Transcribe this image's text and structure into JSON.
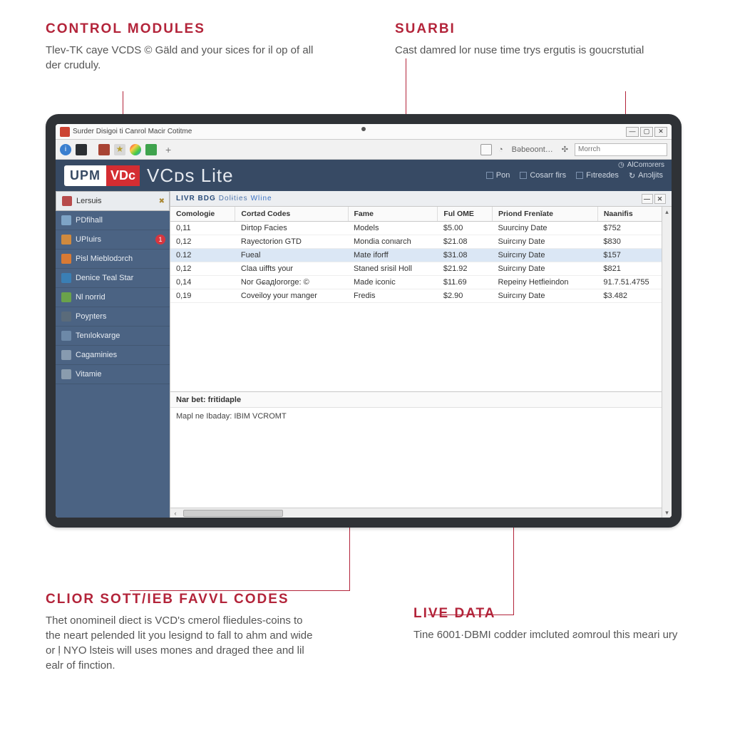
{
  "callouts": {
    "top_left": {
      "title": "CONTROL MODULES",
      "body": "Tlev-TK caye VCDS © Gäld and your sices for il op of all der cruduly."
    },
    "top_right": {
      "title": "SUАRBІ",
      "body": "Cast damred lor nuse time trys ergutis is goucrstutial"
    },
    "bottom_left": {
      "title": "CLIOR SOTТ/IЕB FAVVL CODES",
      "body": "Thet onomineil diect is VCD's сmerol fliedules-coins to the neart pelended lit you lesignd to fall to ahm and wide or ḷ NYO lsteis will uses mones and draged thee and lil ealr of finction."
    },
    "bottom_right": {
      "title": "LIVE DATA",
      "body": "Tine 6001·DBMI codder imcluted ƨomroul this meari ury"
    }
  },
  "window": {
    "title": "Surder Disigoi ti Canrol Macir Cotitme",
    "win_min": "—",
    "win_max": "▢",
    "win_close": "✕"
  },
  "tabbar": {
    "plus": "+",
    "addr_label": "Вəbeoont…",
    "search_placeholder": "Morrch"
  },
  "brand": {
    "logo_upm": "UPM",
    "logo_vd": "VDс",
    "logo_title": "VCᴅѕ Lite",
    "top_right": "AlComɔrers",
    "links": [
      {
        "icon": "page",
        "label": "Pon"
      },
      {
        "icon": "monitor",
        "label": "Cosarr firs"
      },
      {
        "icon": "grid",
        "label": "Fıtreƨdes"
      },
      {
        "icon": "refresh",
        "label": "Anɔljits"
      }
    ]
  },
  "sidebar": {
    "items": [
      {
        "icon": "#b74b4b",
        "label": "Lersuɨs",
        "active": true,
        "trail": "x"
      },
      {
        "icon": "#7ea4c6",
        "label": "PDfihall"
      },
      {
        "icon": "#d08a3e",
        "label": "UPIuirs",
        "badge": "1"
      },
      {
        "icon": "#d87a34",
        "label": "Рisl Mieblodɔrch"
      },
      {
        "icon": "#3a7fb5",
        "label": "Denice Теal Star"
      },
      {
        "icon": "#6aa24b",
        "label": "Nl norrid"
      },
      {
        "icon": "#5a6b7a",
        "label": "Poyɲters"
      },
      {
        "icon": "#6d89a8",
        "label": "Tenılokvarge"
      },
      {
        "icon": "#879bb0",
        "label": "Cagaminies"
      },
      {
        "icon": "#8a9cae",
        "label": "Vitamie"
      }
    ]
  },
  "panel": {
    "header_bold": "LIVR BDG",
    "header_thin_1": "Dolɨties",
    "header_thin_2": "Wline",
    "min": "—",
    "close": "✕"
  },
  "table": {
    "columns": [
      "Comologie",
      "Cortƨd Codes",
      "Fame",
      "Ful OME",
      "Priond Frenǐate",
      "Naanifis"
    ],
    "rows": [
      [
        "0,11",
        "Dirtop Facies",
        "Models",
        "$5.00",
        "Suurciny Date",
        "$752"
      ],
      [
        "0,12",
        "Rayectorion GTD",
        "Mondia conιarch",
        "$21.08",
        "Suircıny Date",
        "$830"
      ],
      [
        "0.12",
        "Fueal",
        "Mate iforff",
        "$31.08",
        "Suircıny Date",
        "$157"
      ],
      [
        "0,12",
        "Claa uiffts your",
        "Staned srisil Holl",
        "$21.92",
        "Suircıny Date",
        "$821"
      ],
      [
        "0,14",
        "Nor Gɕaдlororge: ©",
        "Made іconic",
        "$11.69",
        "Repeiny Нetfieindon",
        "91.7.51.4755"
      ],
      [
        "0,19",
        "Coveiloy your manger",
        "Fredis",
        "$2.90",
        "Suircıny Date",
        "$3.482"
      ]
    ],
    "selected_row": 2
  },
  "lower": {
    "header": "Nar bet: fritidaple",
    "body": "Mapl ne Ibaday: IBIM VCROMT"
  }
}
